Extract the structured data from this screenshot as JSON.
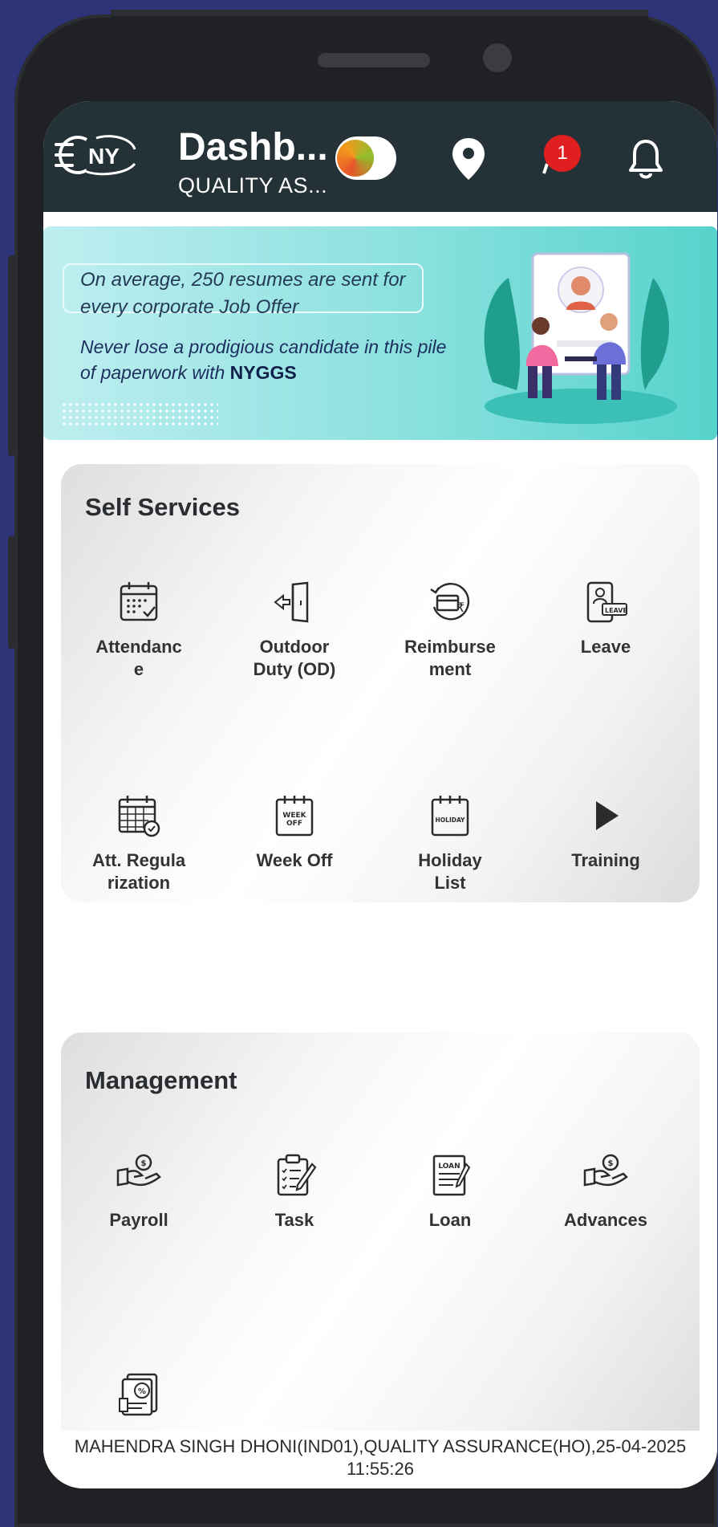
{
  "header": {
    "title": "Dashb...",
    "subtitle": "QUALITY AS...",
    "notification_count": "1"
  },
  "banner": {
    "line1": "On average, 250 resumes are sent for every corporate Job Offer",
    "line2": "Never lose a prodigious candidate in this pile of paperwork with",
    "brand": "NYGGS"
  },
  "self_services": {
    "title": "Self Services",
    "items": [
      {
        "label": "Attendanc\ne",
        "icon": "calendar-check-icon"
      },
      {
        "label": "Outdoor\nDuty (OD)",
        "icon": "door-exit-icon"
      },
      {
        "label": "Reimburse\nment",
        "icon": "reimbursement-icon"
      },
      {
        "label": "Leave",
        "icon": "leave-icon"
      },
      {
        "label": "Att. Regula\nrization",
        "icon": "calendar-regularize-icon"
      },
      {
        "label": "Week Off",
        "icon": "week-off-calendar-icon"
      },
      {
        "label": "Holiday\nList",
        "icon": "holiday-calendar-icon"
      },
      {
        "label": "Training",
        "icon": "play-icon"
      }
    ]
  },
  "management": {
    "title": "Management",
    "items": [
      {
        "label": "Payroll",
        "icon": "payroll-hand-icon"
      },
      {
        "label": "Task",
        "icon": "task-clipboard-icon"
      },
      {
        "label": "Loan",
        "icon": "loan-document-icon"
      },
      {
        "label": "Advances",
        "icon": "advances-hand-icon"
      },
      {
        "label": "",
        "icon": "tax-document-icon"
      }
    ]
  },
  "footer": {
    "user_info": "MAHENDRA SINGH DHONI(IND01),QUALITY ASSURANCE(HO),25-04-2025",
    "time": "11:55:26"
  }
}
